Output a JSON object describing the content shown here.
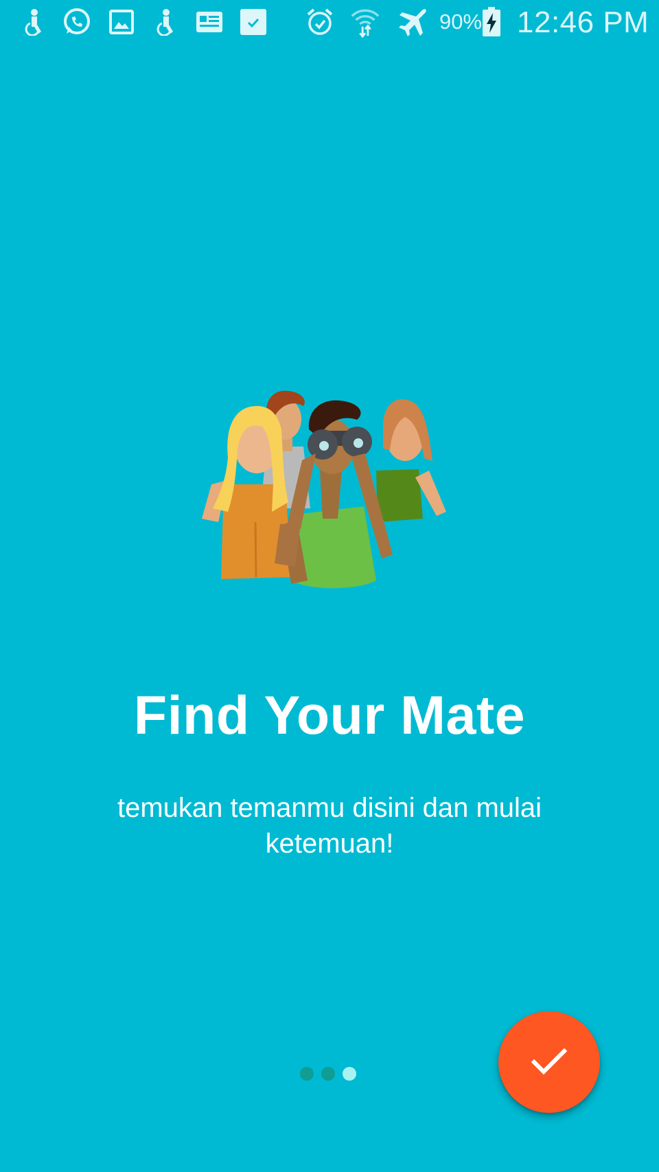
{
  "status_bar": {
    "notification_icons": [
      "accessibility-icon",
      "whatsapp-icon",
      "gallery-icon",
      "accessibility-icon",
      "news-icon",
      "checkbox-icon"
    ],
    "system_icons": [
      "alarm-icon",
      "wifi-icon",
      "airplane-mode-icon",
      "battery-charging-icon"
    ],
    "battery_percent": "90%",
    "time": "12:46 PM",
    "battery_level": 0.9
  },
  "onboarding": {
    "illustration": "group-people-binoculars-illustration",
    "title": "Find Your Mate",
    "subtitle": "temukan temanmu disini dan mulai ketemuan!",
    "page_count": 3,
    "current_page": 3
  },
  "fab": {
    "icon": "check-icon",
    "color": "#FF5722"
  },
  "colors": {
    "background": "#00BAD3",
    "dot_inactive": "#109D93",
    "dot_active": "#A9F2F2",
    "text": "#FFFFFF"
  }
}
